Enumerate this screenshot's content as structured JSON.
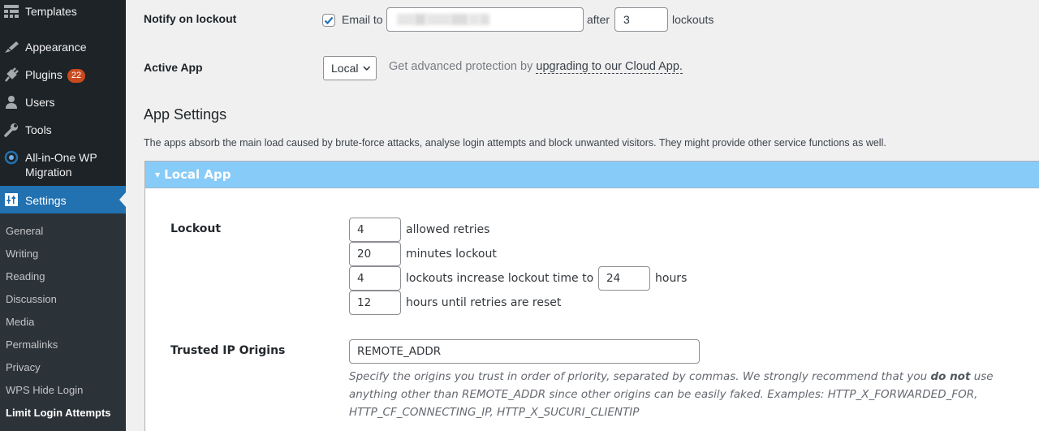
{
  "sidebar": {
    "items": [
      {
        "label": "Templates",
        "icon": "templates-icon"
      },
      {
        "label": "Appearance",
        "icon": "paintbrush-icon"
      },
      {
        "label": "Plugins",
        "icon": "plugin-icon",
        "badge": "22"
      },
      {
        "label": "Users",
        "icon": "user-icon"
      },
      {
        "label": "Tools",
        "icon": "wrench-icon"
      },
      {
        "label": "All-in-One WP Migration",
        "label_line1": "All-in-One WP",
        "label_line2": "Migration",
        "icon": "migration-icon"
      },
      {
        "label": "Settings",
        "icon": "settings-icon",
        "active": true
      }
    ],
    "submenu": [
      {
        "label": "General"
      },
      {
        "label": "Writing"
      },
      {
        "label": "Reading"
      },
      {
        "label": "Discussion"
      },
      {
        "label": "Media"
      },
      {
        "label": "Permalinks"
      },
      {
        "label": "Privacy"
      },
      {
        "label": "WPS Hide Login"
      },
      {
        "label": "Limit Login Attempts",
        "current": true
      }
    ]
  },
  "notify": {
    "label": "Notify on lockout",
    "checked": true,
    "email_label": "Email to",
    "email_value": "",
    "after_label": "after",
    "after_value": "3",
    "lockouts_label": "lockouts"
  },
  "active_app": {
    "label": "Active App",
    "selected": "Local",
    "promo_prefix": "Get advanced protection by",
    "promo_link": "upgrading to our Cloud App."
  },
  "app_settings": {
    "heading": "App Settings",
    "description": "The apps absorb the main load caused by brute-force attacks, analyse login attempts and block unwanted visitors. They might provide other service functions as well."
  },
  "local_app": {
    "title": "Local App",
    "lockout": {
      "label": "Lockout",
      "allowed_retries": "4",
      "allowed_retries_label": "allowed retries",
      "minutes_lockout": "20",
      "minutes_lockout_label": "minutes lockout",
      "lockouts_increase": "4",
      "lockouts_increase_label": "lockouts increase lockout time to",
      "increase_hours": "24",
      "hours_label": "hours",
      "reset_hours": "12",
      "reset_hours_label": "hours until retries are reset"
    },
    "trusted_ip": {
      "label": "Trusted IP Origins",
      "value": "REMOTE_ADDR",
      "help_part1": "Specify the origins you trust in order of priority, separated by commas. We strongly recommend that you ",
      "help_bold": "do not",
      "help_part2": " use anything other than REMOTE_ADDR since other origins can be easily faked. Examples: HTTP_X_FORWARDED_FOR, HTTP_CF_CONNECTING_IP, HTTP_X_SUCURI_CLIENTIP"
    }
  },
  "colors": {
    "sidebar_bg": "#1d2327",
    "submenu_bg": "#2c3338",
    "active_bg": "#2271b1",
    "badge_bg": "#ca4a1f",
    "panel_header_bg": "#87cbf8",
    "page_bg": "#f0f0f1"
  }
}
